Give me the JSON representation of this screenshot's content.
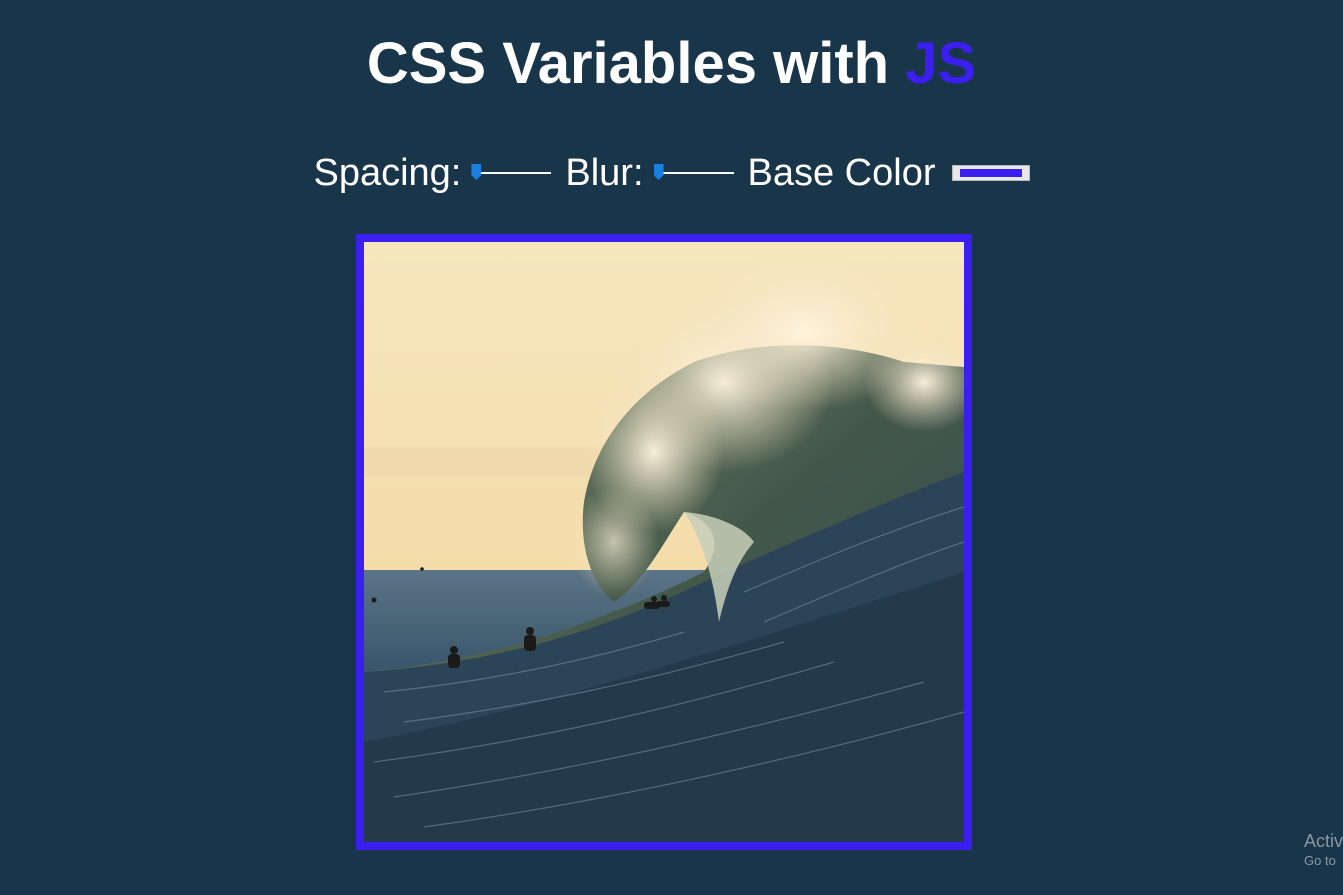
{
  "heading": {
    "prefix": "CSS Variables with ",
    "highlight": "JS"
  },
  "controls": {
    "spacing": {
      "label": "Spacing:",
      "value": 0
    },
    "blur": {
      "label": "Blur:",
      "value": 0
    },
    "base_color": {
      "label": "Base Color",
      "value": "#3b1ef0"
    }
  },
  "colors": {
    "background": "#193549",
    "accent": "#3b1ef0",
    "slider_thumb": "#1a7fe0"
  },
  "watermark": {
    "line1": "Activ",
    "line2": "Go to"
  }
}
